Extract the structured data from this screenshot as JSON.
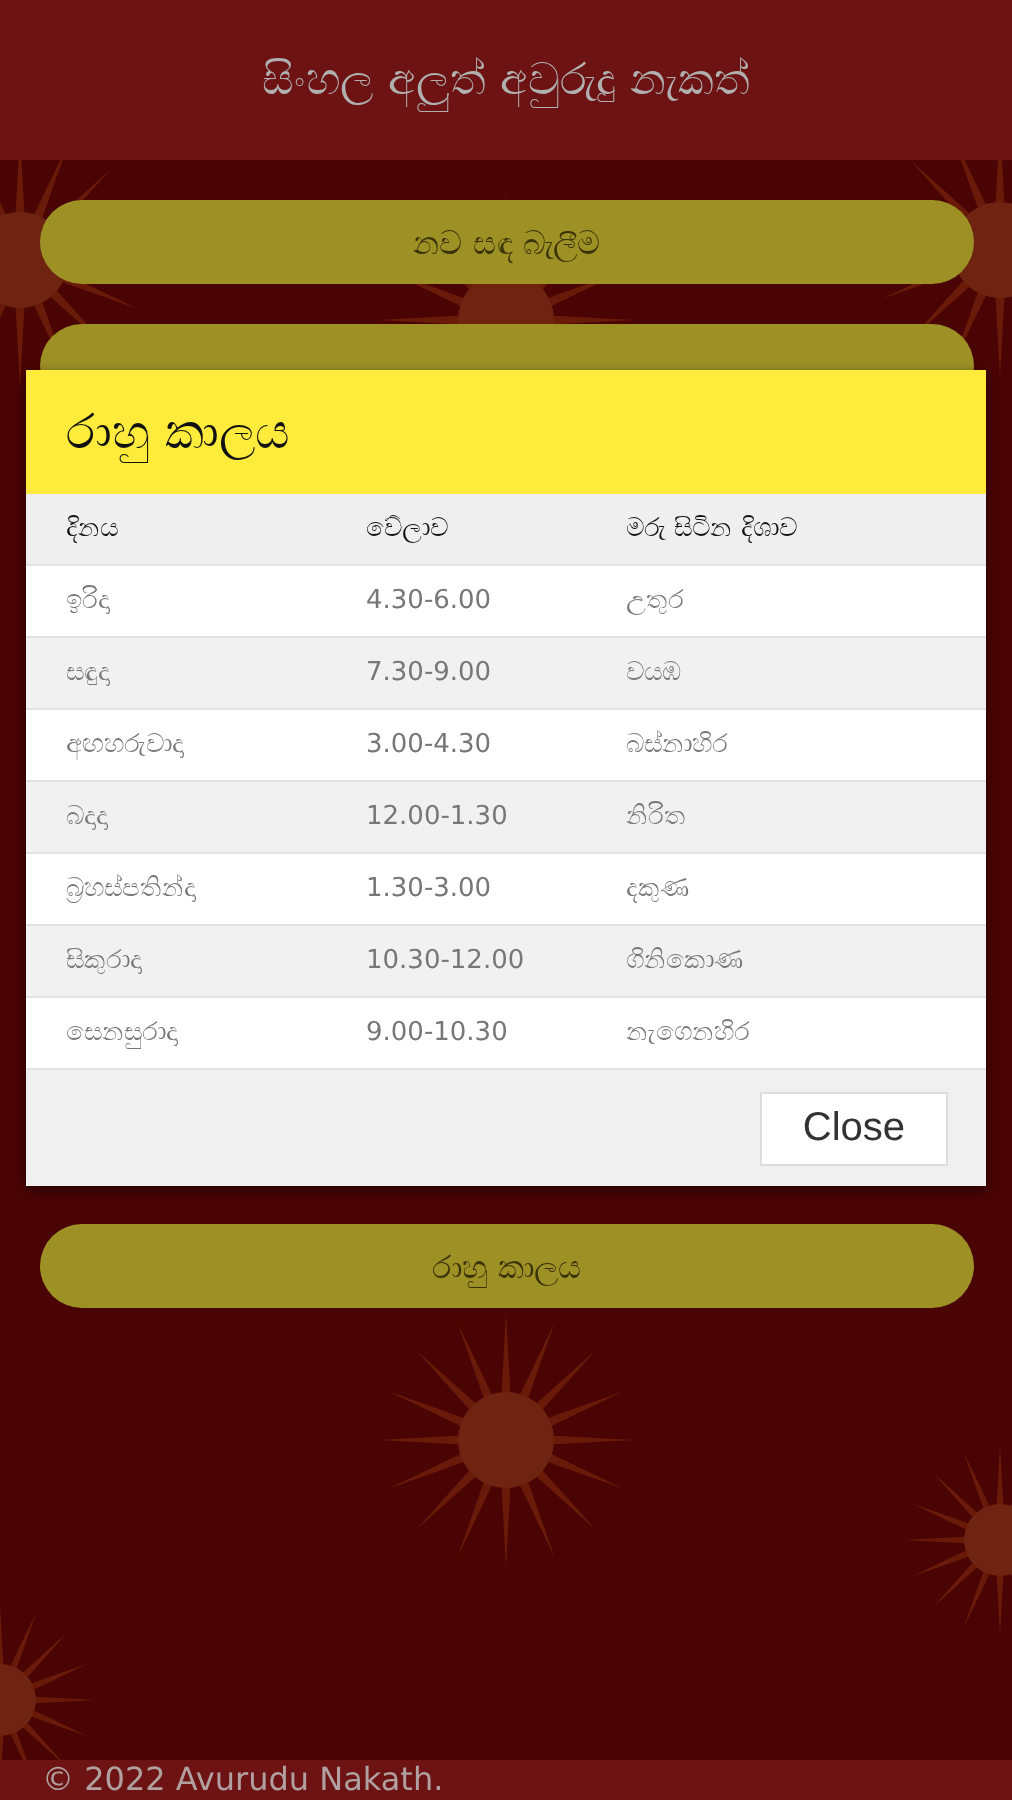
{
  "app_bar": {
    "title": "සිංහල අලුත් අවුරුදු නැකත්"
  },
  "menu_buttons": [
    {
      "kind": "labelled",
      "label": "නව සඳ බැලීම"
    },
    {
      "kind": "covered"
    },
    {
      "kind": "labelled",
      "label": "රාහු කාලය"
    }
  ],
  "dialog": {
    "title": "රාහු කාලය",
    "table": {
      "columns": [
        "දිනය",
        "වේලාව",
        "මරු සිටින දිශාව"
      ],
      "rows": [
        [
          "ඉරිදා",
          "4.30-6.00",
          "උතුර"
        ],
        [
          "සඳුදා",
          "7.30-9.00",
          "වයඹ"
        ],
        [
          "අඟහරුවාදා",
          "3.00-4.30",
          "බස්නාහිර"
        ],
        [
          "බදාදා",
          "12.00-1.30",
          "නිරිත"
        ],
        [
          "බ්‍රහස්පතින්දා",
          "1.30-3.00",
          "දකුණ"
        ],
        [
          "සිකුරාදා",
          "10.30-12.00",
          "ගිනිකොණ"
        ],
        [
          "සෙනසුරාදා",
          "9.00-10.30",
          "නැගෙනහිර"
        ]
      ]
    },
    "close_button": "Close"
  },
  "footer": "© 2022 Avurudu Nakath."
}
